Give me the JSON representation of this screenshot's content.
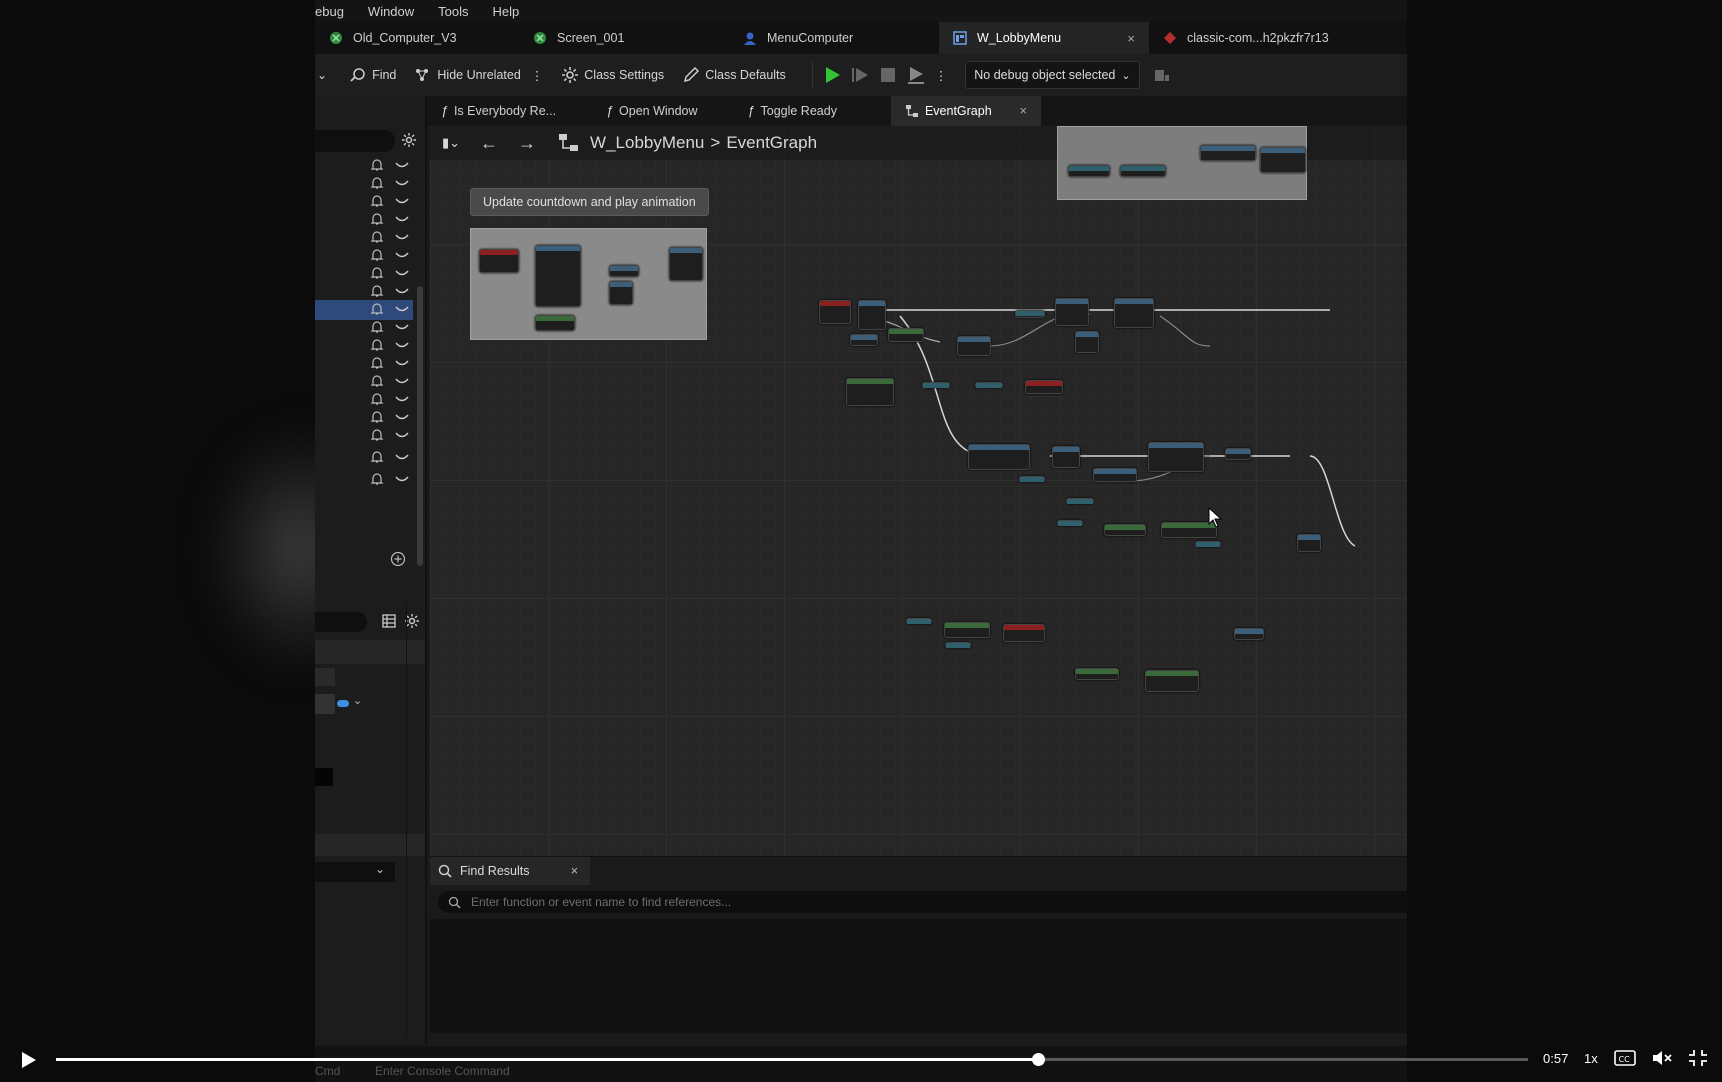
{
  "menu": {
    "items": [
      "ebug",
      "Window",
      "Tools",
      "Help"
    ]
  },
  "asset_tabs": [
    {
      "label": "Old_Computer_V3"
    },
    {
      "label": "Screen_001"
    },
    {
      "label": "MenuComputer"
    },
    {
      "label": "W_LobbyMenu",
      "close": "×"
    },
    {
      "label": "classic-com...h2pkzfr7r13"
    }
  ],
  "toolbar": {
    "find": "Find",
    "hide_unrelated": "Hide Unrelated",
    "class_settings": "Class Settings",
    "class_defaults": "Class Defaults",
    "debug_object": "No debug object selected"
  },
  "function_tabs": [
    {
      "label": "Is Everybody Re..."
    },
    {
      "label": "Open Window"
    },
    {
      "label": "Toggle Ready"
    },
    {
      "label": "EventGraph",
      "close": "×"
    }
  ],
  "breadcrumb": {
    "root": "W_LobbyMenu",
    "separator": ">",
    "current": "EventGraph"
  },
  "comment_bubble": "Update countdown and play animation",
  "find_results": {
    "tab_label": "Find Results",
    "close": "×",
    "placeholder": "Enter function or event name to find references..."
  },
  "console": {
    "prefix": "Cmd",
    "placeholder": "Enter Console Command"
  },
  "video": {
    "time": "0:57",
    "speed": "1x",
    "progress": 0.667
  },
  "colors": {
    "selected_row": "#2d4a7a",
    "play_green": "#35c435",
    "accent_blue": "#3b5e7a"
  }
}
